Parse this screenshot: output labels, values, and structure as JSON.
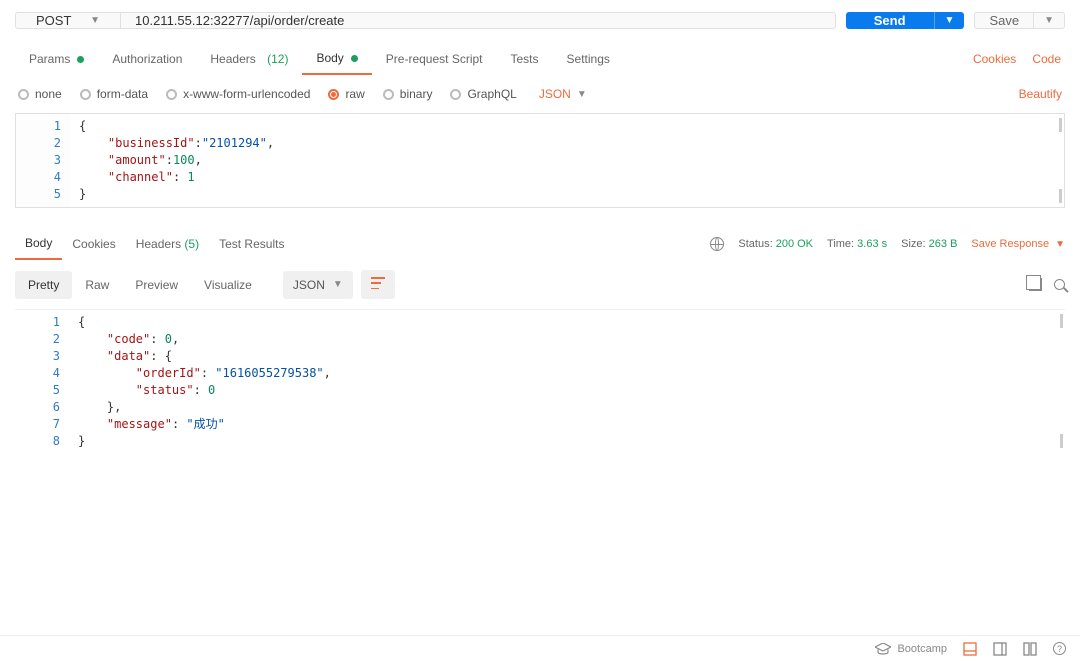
{
  "request": {
    "method": "POST",
    "url": "10.211.55.12:32277/api/order/create",
    "send_label": "Send",
    "save_label": "Save"
  },
  "main_tabs": {
    "params": "Params",
    "authorization": "Authorization",
    "headers": "Headers",
    "headers_count": "(12)",
    "body": "Body",
    "prerequest": "Pre-request Script",
    "tests": "Tests",
    "settings": "Settings",
    "cookies_link": "Cookies",
    "code_link": "Code"
  },
  "body_types": {
    "none": "none",
    "formdata": "form-data",
    "xwww": "x-www-form-urlencoded",
    "raw": "raw",
    "binary": "binary",
    "graphql": "GraphQL",
    "json": "JSON",
    "beautify": "Beautify"
  },
  "request_body": {
    "lines": [
      "1",
      "2",
      "3",
      "4",
      "5"
    ],
    "l1_brace": "{",
    "l2_key": "\"businessId\"",
    "l2_val": "\"2101294\"",
    "l3_key": "\"amount\"",
    "l3_val": "100",
    "l4_key": "\"channel\"",
    "l4_val": "1",
    "l5_brace": "}"
  },
  "response_tabs": {
    "body": "Body",
    "cookies": "Cookies",
    "headers": "Headers",
    "headers_count": "(5)",
    "test_results": "Test Results"
  },
  "response_meta": {
    "status_label": "Status:",
    "status_value": "200 OK",
    "time_label": "Time:",
    "time_value": "3.63 s",
    "size_label": "Size:",
    "size_value": "263 B",
    "save_response": "Save Response"
  },
  "view_tabs": {
    "pretty": "Pretty",
    "raw": "Raw",
    "preview": "Preview",
    "visualize": "Visualize",
    "json": "JSON"
  },
  "response_body": {
    "lines": [
      "1",
      "2",
      "3",
      "4",
      "5",
      "6",
      "7",
      "8"
    ],
    "l1": "{",
    "l2_key": "\"code\"",
    "l2_val": "0",
    "l3_key": "\"data\"",
    "l4_key": "\"orderId\"",
    "l4_val": "\"1616055279538\"",
    "l5_key": "\"status\"",
    "l5_val": "0",
    "l7_key": "\"message\"",
    "l7_val": "\"成功\"",
    "l8": "}"
  },
  "status_bar": {
    "bootcamp": "Bootcamp"
  }
}
